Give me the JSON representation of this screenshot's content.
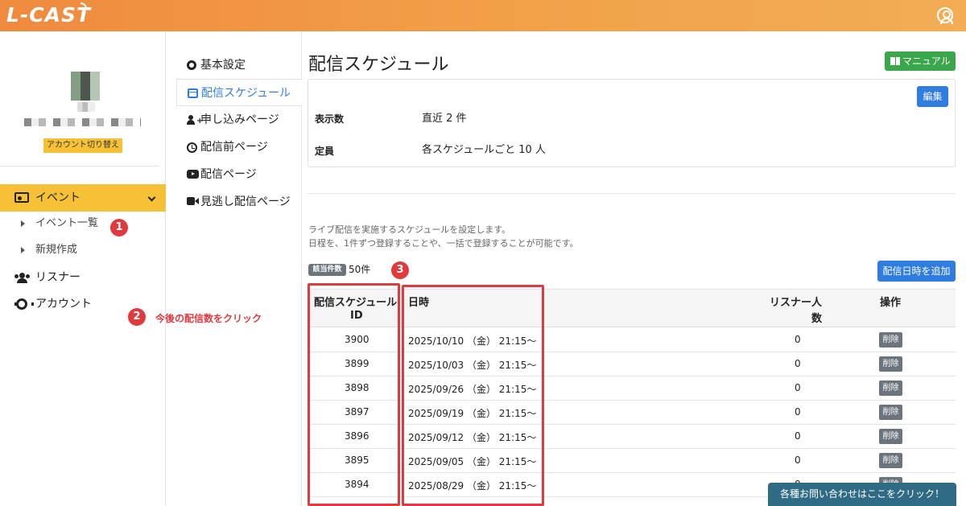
{
  "app": {
    "logo": "L-CAST"
  },
  "sidebar": {
    "switch_account": "アカウント切り替え",
    "event": "イベント",
    "event_list": "イベント一覧",
    "new_create": "新規作成",
    "listener": "リスナー",
    "account": "アカウント"
  },
  "subnav": {
    "basic": "基本設定",
    "schedule": "配信スケジュール",
    "application": "申し込みページ",
    "pre_stream": "配信前ページ",
    "stream": "配信ページ",
    "replay": "見逃し配信ページ"
  },
  "main": {
    "title": "配信スケジュール",
    "manual_label": "マニュアル",
    "edit_label": "編集",
    "display_label": "表示数",
    "display_value": "直近 2 件",
    "capacity_label": "定員",
    "capacity_value": "各スケジュールごと 10 人",
    "desc1": "ライブ配信を実施するスケジュールを設定します。",
    "desc2": "日程を、1件ずつ登録することや、一括で登録することが可能です。",
    "count_badge": "該当件数",
    "count_value": "50件",
    "add_label": "配信日時を追加"
  },
  "table": {
    "col_id_1": "配信スケジュール",
    "col_id_2": "ID",
    "col_date": "日時",
    "col_listener_1": "リスナー人",
    "col_listener_2": "数",
    "col_action": "操作",
    "rows": [
      {
        "id": "3900",
        "date": "2025/10/10 （金） 21:15〜",
        "listeners": "0",
        "action": "削除"
      },
      {
        "id": "3899",
        "date": "2025/10/03 （金） 21:15〜",
        "listeners": "0",
        "action": "削除"
      },
      {
        "id": "3898",
        "date": "2025/09/26 （金） 21:15〜",
        "listeners": "0",
        "action": "削除"
      },
      {
        "id": "3897",
        "date": "2025/09/19 （金） 21:15〜",
        "listeners": "0",
        "action": "削除"
      },
      {
        "id": "3896",
        "date": "2025/09/12 （金） 21:15〜",
        "listeners": "0",
        "action": "削除"
      },
      {
        "id": "3895",
        "date": "2025/09/05 （金） 21:15〜",
        "listeners": "0",
        "action": "削除"
      },
      {
        "id": "3894",
        "date": "2025/08/29 （金） 21:15〜",
        "listeners": "0",
        "action": "削除"
      }
    ]
  },
  "annotations": {
    "m1": "1",
    "m2": "2",
    "m3": "3",
    "text2": "今後の配信数をクリック"
  },
  "contact": "各種お問い合わせはここをクリック！"
}
